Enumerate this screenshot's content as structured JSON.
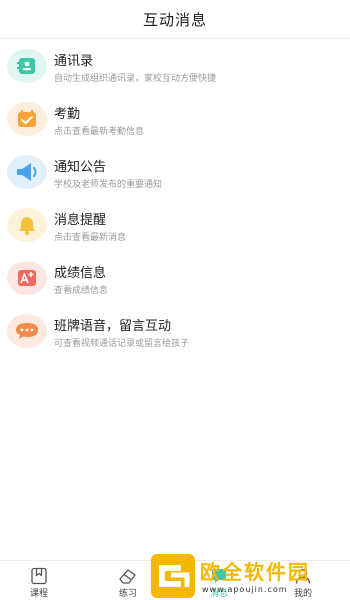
{
  "header": {
    "title": "互动消息"
  },
  "items": [
    {
      "title": "通讯录",
      "subtitle": "自动生成组织通讯录，家校互动方便快捷",
      "icon": "contacts-icon",
      "color": "#3ec6a6",
      "bg": "#e0f6f0"
    },
    {
      "title": "考勤",
      "subtitle": "点击查看最新考勤信息",
      "icon": "attendance-icon",
      "color": "#f7a23a",
      "bg": "#fdeedd"
    },
    {
      "title": "通知公告",
      "subtitle": "学校及老师发布的重要通知",
      "icon": "megaphone-icon",
      "color": "#4aa3f0",
      "bg": "#e2f0fd"
    },
    {
      "title": "消息提醒",
      "subtitle": "点击查看最新消息",
      "icon": "bell-icon",
      "color": "#f6c13c",
      "bg": "#fdf3da"
    },
    {
      "title": "成绩信息",
      "subtitle": "查看成绩信息",
      "icon": "grade-icon",
      "color": "#f26a5e",
      "bg": "#fde5e3"
    },
    {
      "title": "班牌语音，留言互动",
      "subtitle": "可查看视频通话记录或留言给孩子",
      "icon": "chat-bubble-icon",
      "color": "#f58a4c",
      "bg": "#fde9dd"
    }
  ],
  "tabbar": {
    "tabs": [
      {
        "label": "课程",
        "icon": "bookmark-icon"
      },
      {
        "label": "练习",
        "icon": "eraser-icon"
      },
      {
        "label": "消息",
        "icon": "message-icon"
      },
      {
        "label": "我的",
        "icon": "profile-icon"
      }
    ]
  },
  "watermark": {
    "name": "欧全软件园",
    "url": "www.apoujin.com"
  }
}
